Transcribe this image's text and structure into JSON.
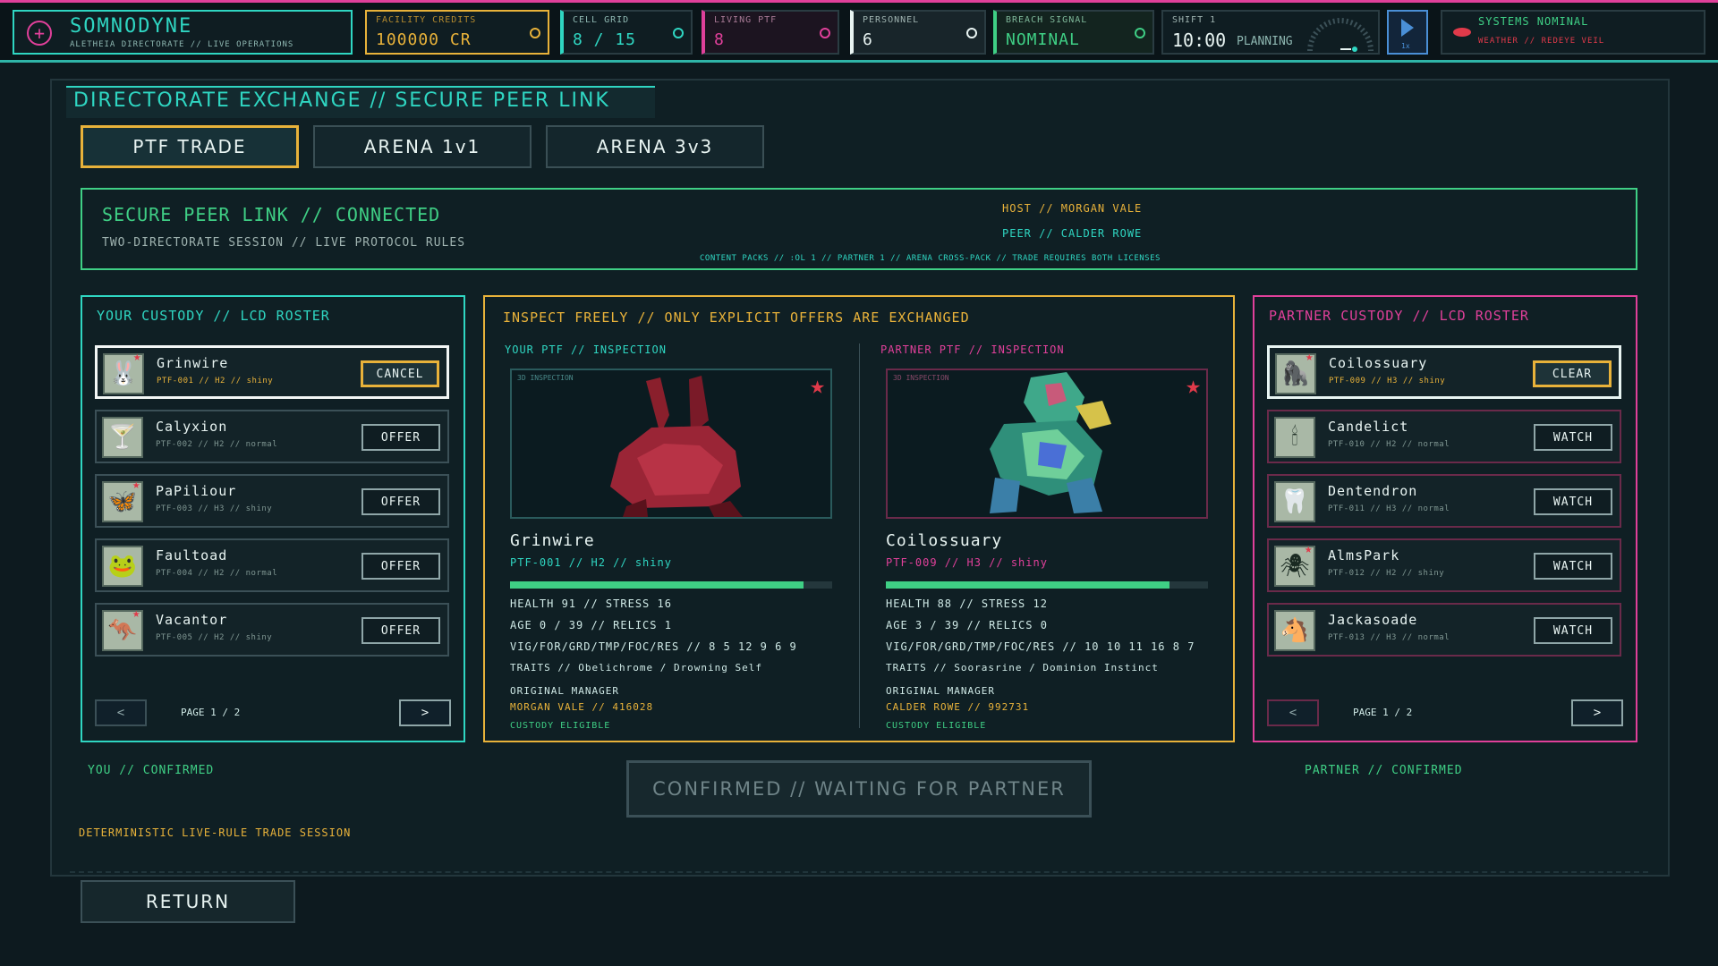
{
  "hud": {
    "logo_title": "SOMNODYNE",
    "logo_subtitle": "ALETHEIA DIRECTORATE // LIVE OPERATIONS",
    "credits_label": "FACILITY CREDITS",
    "credits_value": "100000 CR",
    "cell_grid_label": "CELL GRID",
    "cell_grid_value": "8 / 15",
    "living_label": "LIVING PTF",
    "living_value": "8",
    "personnel_label": "PERSONNEL",
    "personnel_value": "6",
    "breach_label": "BREACH SIGNAL",
    "breach_value": "NOMINAL",
    "shift_label": "SHIFT 1",
    "shift_time": "10:00",
    "shift_phase": "PLANNING",
    "speed_label": "1x",
    "status_title": "SYSTEMS NOMINAL",
    "status_sub": "WEATHER // REDEYE VEIL",
    "colors": {
      "cyan": "#2fd6c2",
      "gold": "#e8b23a",
      "pink": "#e0409a",
      "green": "#3fcf85",
      "red": "#e03a4a"
    }
  },
  "page": {
    "title": "DIRECTORATE EXCHANGE // SECURE PEER LINK",
    "tabs": [
      {
        "label": "PTF TRADE",
        "active": true
      },
      {
        "label": "ARENA 1v1",
        "active": false
      },
      {
        "label": "ARENA 3v3",
        "active": false
      }
    ],
    "link": {
      "title": "SECURE PEER LINK // CONNECTED",
      "subtitle": "TWO-DIRECTORATE SESSION // LIVE PROTOCOL RULES",
      "host": "HOST // MORGAN VALE",
      "peer": "PEER // CALDER ROWE",
      "packs": "CONTENT PACKS // :OL 1 // PARTNER 1 // ARENA CROSS-PACK // TRADE REQUIRES BOTH LICENSES"
    },
    "your_roster": {
      "header": "YOUR CUSTODY // LCD ROSTER",
      "items": [
        {
          "name": "Grinwire",
          "sub": "PTF-001 // H2 // shiny",
          "button": "CANCEL",
          "selected": true,
          "shiny": true,
          "glyph": "🐰"
        },
        {
          "name": "Calyxion",
          "sub": "PTF-002 // H2 // normal",
          "button": "OFFER",
          "selected": false,
          "shiny": false,
          "glyph": "🍸"
        },
        {
          "name": "PaPiliour",
          "sub": "PTF-003 // H3 // shiny",
          "button": "OFFER",
          "selected": false,
          "shiny": true,
          "glyph": "🦋"
        },
        {
          "name": "Faultoad",
          "sub": "PTF-004 // H2 // normal",
          "button": "OFFER",
          "selected": false,
          "shiny": false,
          "glyph": "🐸"
        },
        {
          "name": "Vacantor",
          "sub": "PTF-005 // H2 // shiny",
          "button": "OFFER",
          "selected": false,
          "shiny": true,
          "glyph": "🦘"
        }
      ],
      "page": "PAGE 1 / 2",
      "prev": "<",
      "next": ">"
    },
    "partner_roster": {
      "header": "PARTNER CUSTODY // LCD ROSTER",
      "items": [
        {
          "name": "Coilossuary",
          "sub": "PTF-009 // H3 // shiny",
          "button": "CLEAR",
          "selected": true,
          "shiny": true,
          "glyph": "🦍"
        },
        {
          "name": "Candelict",
          "sub": "PTF-010 // H2 // normal",
          "button": "WATCH",
          "selected": false,
          "shiny": false,
          "glyph": "🕯"
        },
        {
          "name": "Dentendron",
          "sub": "PTF-011 // H3 // normal",
          "button": "WATCH",
          "selected": false,
          "shiny": false,
          "glyph": "🦷"
        },
        {
          "name": "AlmsPark",
          "sub": "PTF-012 // H2 // shiny",
          "button": "WATCH",
          "selected": false,
          "shiny": true,
          "glyph": "🕷"
        },
        {
          "name": "Jackasoade",
          "sub": "PTF-013 // H3 // normal",
          "button": "WATCH",
          "selected": false,
          "shiny": false,
          "glyph": "🐴"
        }
      ],
      "page": "PAGE 1 / 2",
      "prev": "<",
      "next": ">"
    },
    "inspect": {
      "header": "INSPECT FREELY // ONLY EXPLICIT OFFERS ARE EXCHANGED",
      "left": {
        "header": "YOUR PTF // INSPECTION",
        "badge": "3D INSPECTION",
        "name": "Grinwire",
        "sub": "PTF-001 // H2 // shiny",
        "health_fraction": 0.91,
        "line1": "HEALTH 91 // STRESS 16",
        "line2": "AGE 0 / 39 // RELICS 1",
        "line3": "VIG/FOR/GRD/TMP/FOC/RES // 8 5 12 9 6 9",
        "line4": "TRAITS // Obelichrome / Drowning Self",
        "manager_label": "ORIGINAL MANAGER",
        "manager_value": "MORGAN VALE // 416028",
        "custody": "CUSTODY ELIGIBLE"
      },
      "right": {
        "header": "PARTNER PTF // INSPECTION",
        "badge": "3D INSPECTION",
        "name": "Coilossuary",
        "sub": "PTF-009 // H3 // shiny",
        "health_fraction": 0.88,
        "line1": "HEALTH 88 // STRESS 12",
        "line2": "AGE 3 / 39 // RELICS 0",
        "line3": "VIG/FOR/GRD/TMP/FOC/RES // 10 10 11 16 8 7",
        "line4": "TRAITS // Soorasrine / Dominion Instinct",
        "manager_label": "ORIGINAL MANAGER",
        "manager_value": "CALDER ROWE // 992731",
        "custody": "CUSTODY ELIGIBLE"
      }
    },
    "you_confirmed": "YOU // CONFIRMED",
    "partner_confirmed": "PARTNER // CONFIRMED",
    "confirm_button": "CONFIRMED // WAITING FOR PARTNER",
    "footer_note": "DETERMINISTIC LIVE-RULE TRADE SESSION",
    "return_button": "RETURN"
  }
}
